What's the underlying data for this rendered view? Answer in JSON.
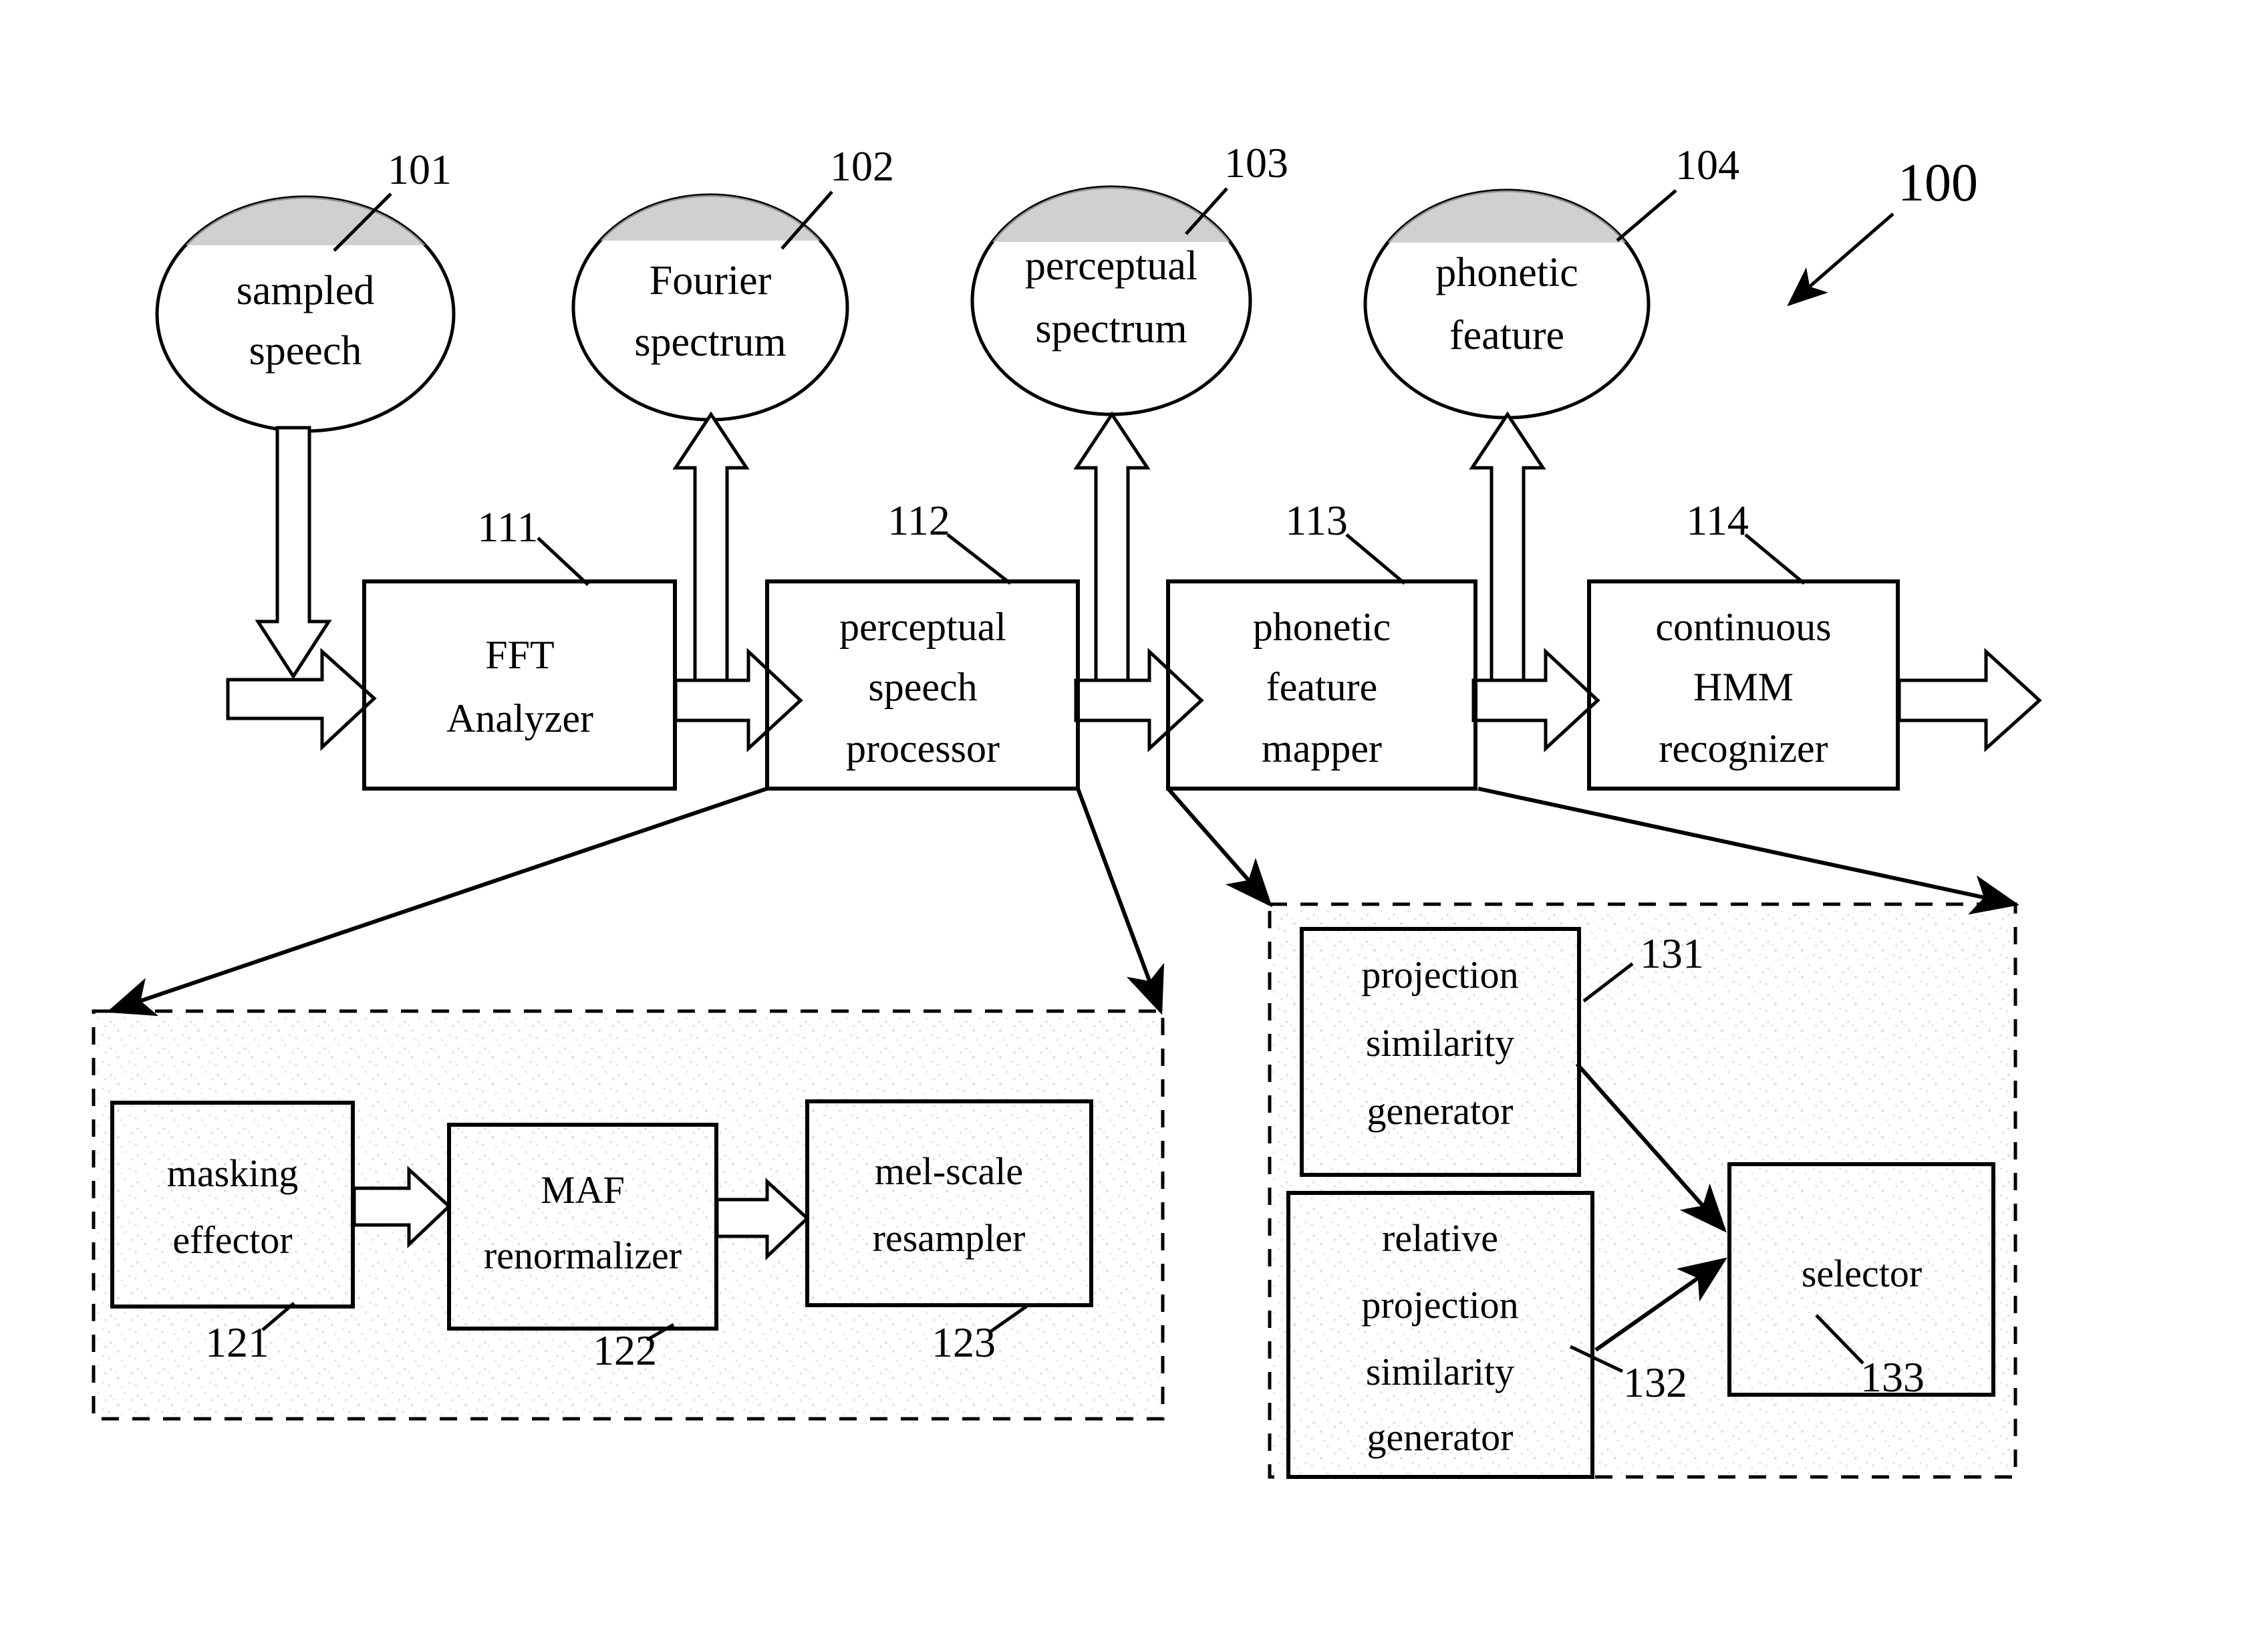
{
  "figure": {
    "overall_ref": "100",
    "data_nodes": [
      {
        "id": "n101",
        "ref": "101",
        "line1": "sampled",
        "line2": "speech"
      },
      {
        "id": "n102",
        "ref": "102",
        "line1": "Fourier",
        "line2": "spectrum"
      },
      {
        "id": "n103",
        "ref": "103",
        "line1": "perceptual",
        "line2": "spectrum"
      },
      {
        "id": "n104",
        "ref": "104",
        "line1": "phonetic",
        "line2": "feature"
      }
    ],
    "pipeline_blocks": [
      {
        "id": "b111",
        "ref": "111",
        "line1": "FFT",
        "line2": "Analyzer",
        "line3": ""
      },
      {
        "id": "b112",
        "ref": "112",
        "line1": "perceptual",
        "line2": "speech",
        "line3": "processor"
      },
      {
        "id": "b113",
        "ref": "113",
        "line1": "phonetic",
        "line2": "feature",
        "line3": "mapper"
      },
      {
        "id": "b114",
        "ref": "114",
        "line1": "continuous",
        "line2": "HMM",
        "line3": "recognizer"
      }
    ],
    "perceptual_detail_group": {
      "blocks": [
        {
          "id": "b121",
          "ref": "121",
          "line1": "masking",
          "line2": "effector",
          "line3": ""
        },
        {
          "id": "b122",
          "ref": "122",
          "line1": "MAF",
          "line2": "renormalizer",
          "line3": ""
        },
        {
          "id": "b123",
          "ref": "123",
          "line1": "mel-scale",
          "line2": "resampler",
          "line3": ""
        }
      ]
    },
    "mapper_detail_group": {
      "blocks": [
        {
          "id": "b131",
          "ref": "131",
          "line1": "projection",
          "line2": "similarity",
          "line3": "generator",
          "line4": ""
        },
        {
          "id": "b132",
          "ref": "132",
          "line1": "relative",
          "line2": "projection",
          "line3": "similarity",
          "line4": "generator"
        },
        {
          "id": "b133",
          "ref": "133",
          "line1": "selector",
          "line2": "",
          "line3": "",
          "line4": ""
        }
      ]
    },
    "colors": {
      "ink": "#000000",
      "paper": "#ffffff",
      "shade": "#c9c9c9"
    }
  }
}
